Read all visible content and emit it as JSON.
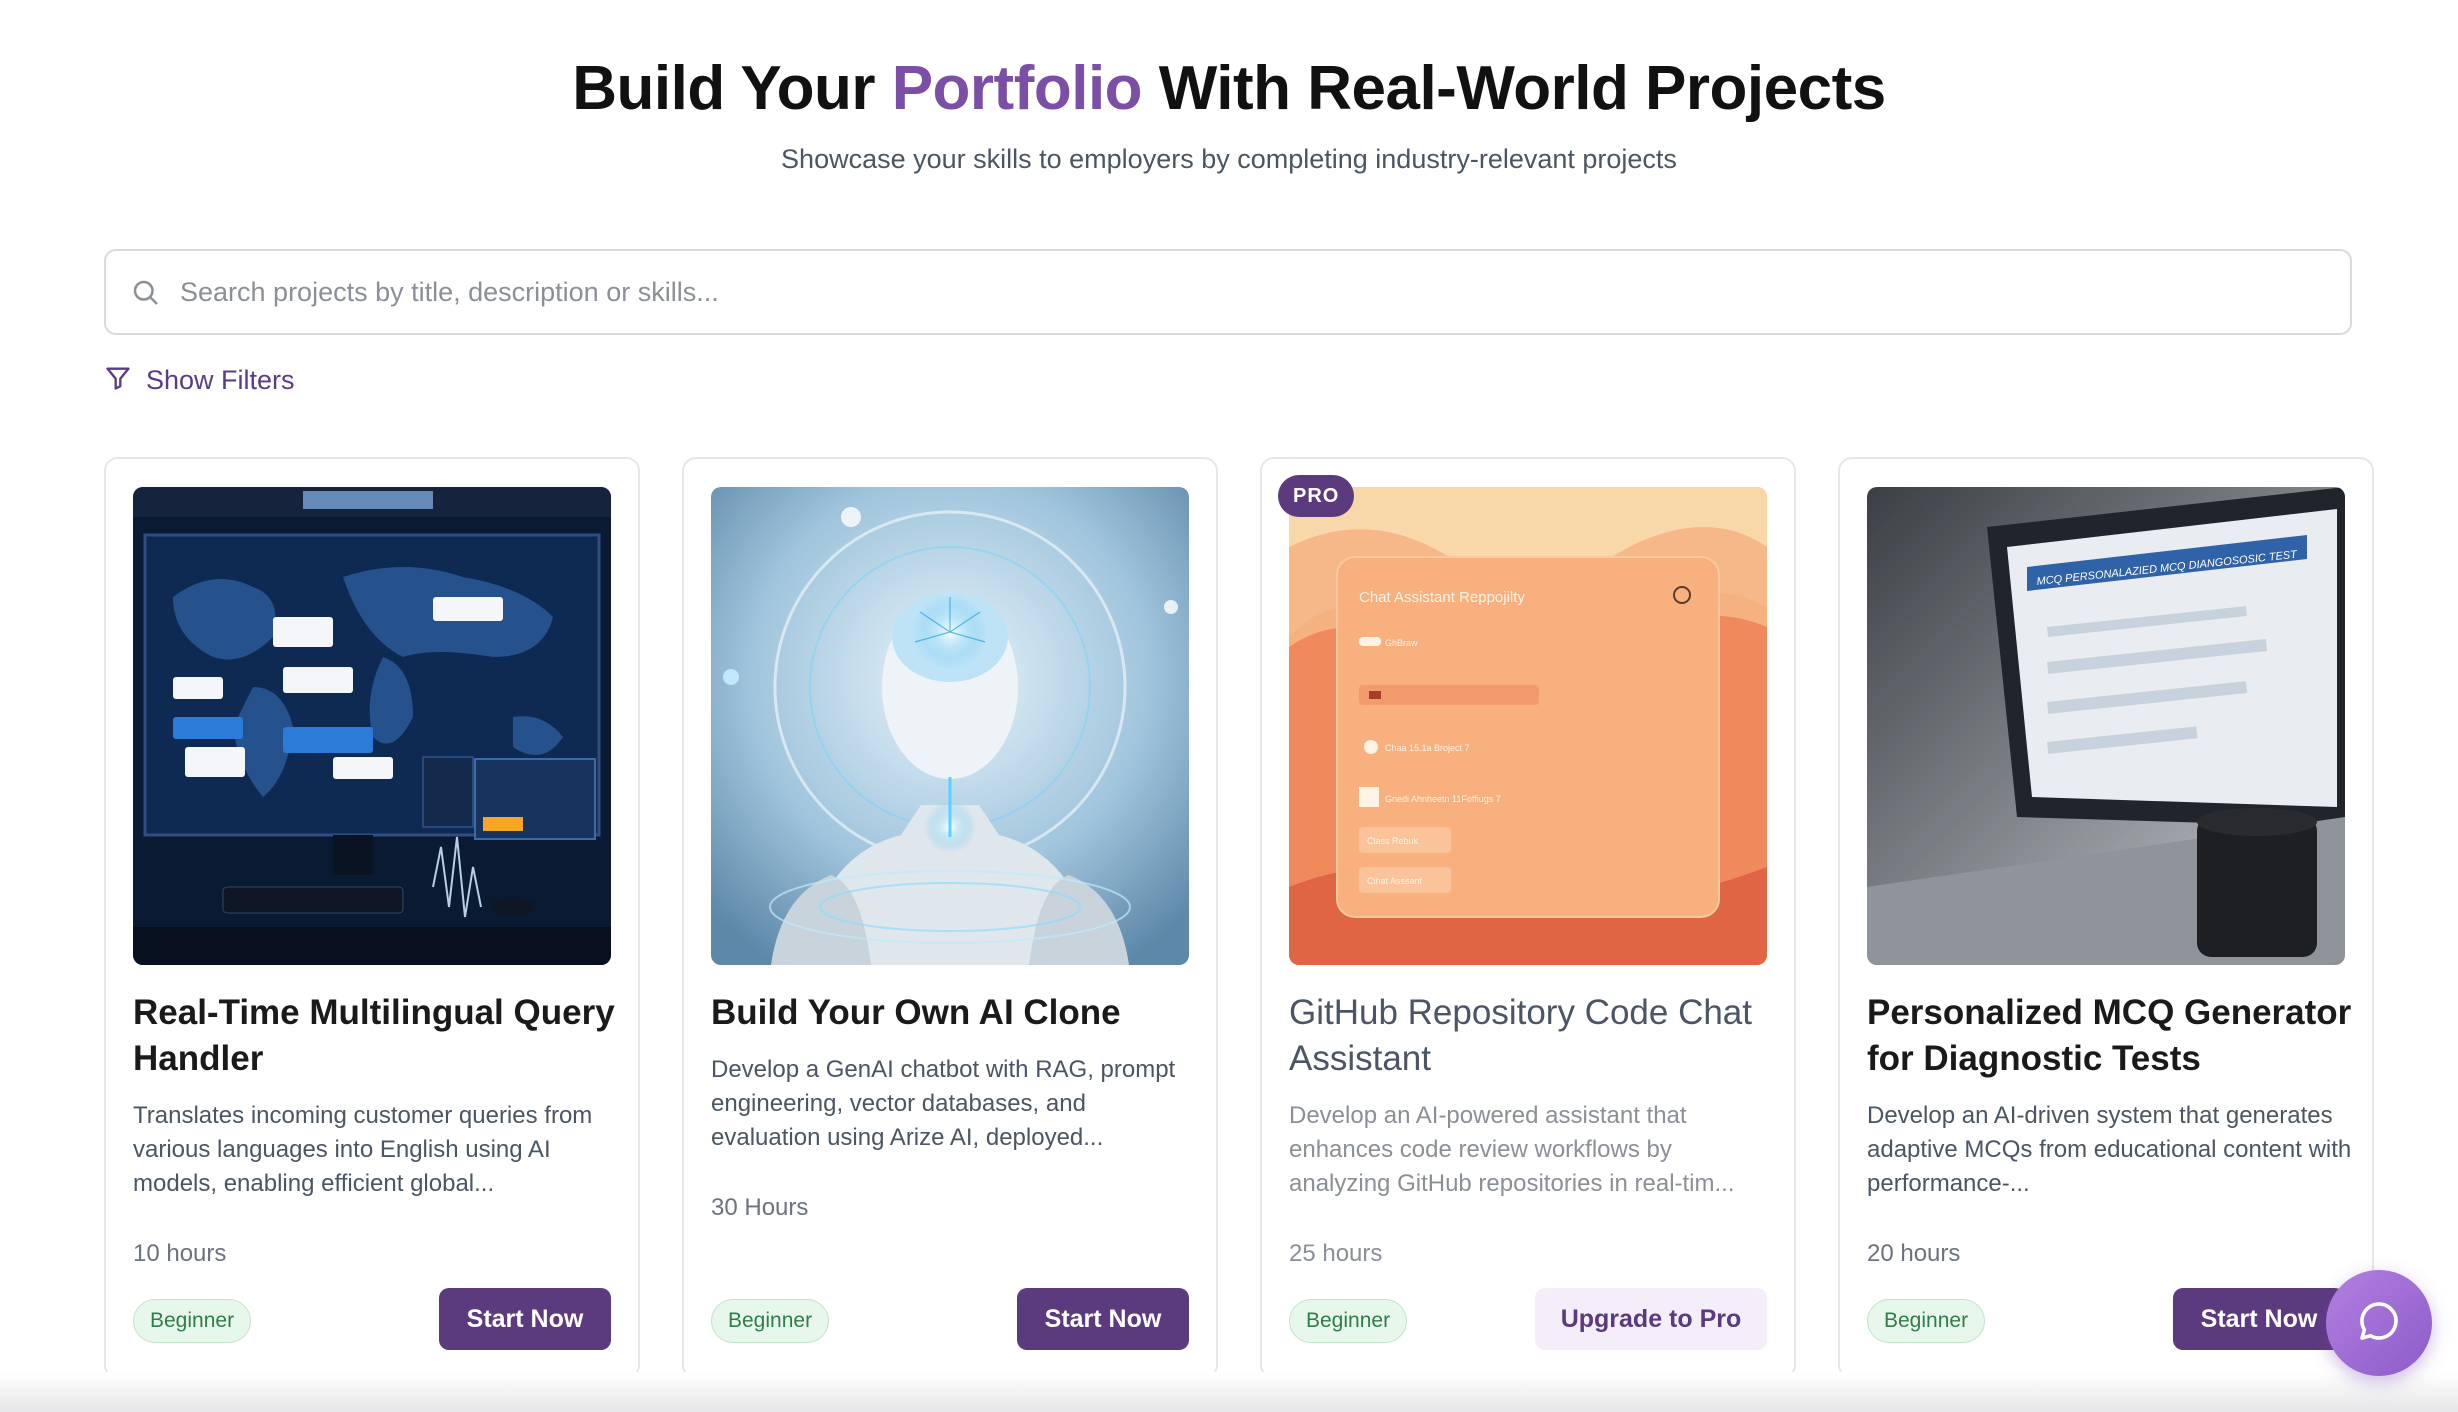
{
  "header": {
    "title_before": "Build Your ",
    "title_accent": "Portfolio",
    "title_after": " With Real-World Projects",
    "subtitle": "Showcase your skills to employers by completing industry-relevant projects"
  },
  "search": {
    "placeholder": "Search projects by title, description or skills...",
    "value": ""
  },
  "filters": {
    "label": "Show Filters"
  },
  "colors": {
    "accent": "#7b4fa5",
    "button": "#5b3a7e",
    "badge_bg": "#e8f7ec",
    "badge_text": "#2f7d4a"
  },
  "cards": [
    {
      "title": "Real-Time Multilingual Query Handler",
      "description": "Translates incoming customer queries from various languages into English using AI models, enabling efficient global...",
      "duration": "10 hours",
      "level": "Beginner",
      "action": "Start Now"
    },
    {
      "title": "Build Your Own AI Clone",
      "description": "Develop a GenAI chatbot with RAG, prompt engineering, vector databases, and evaluation using Arize AI, deployed...",
      "duration": "30 Hours",
      "level": "Beginner",
      "action": "Start Now"
    },
    {
      "badge": "PRO",
      "title": "GitHub Repository Code Chat Assistant",
      "description": "Develop an AI-powered assistant that enhances code review workflows by analyzing GitHub repositories in real-tim...",
      "duration": "25 hours",
      "level": "Beginner",
      "action": "Upgrade to Pro",
      "image_texts": {
        "window_title": "Chat Assistant Reppojilty",
        "row1": "GhBraw",
        "row3": "Chaa 15.1a Broject 7",
        "row4": "Gnedi Ahnheetn 11Foffiugs 7",
        "btn1": "Class Rebuk",
        "btn2": "Cihat Asssant"
      }
    },
    {
      "title": "Personalized MCQ Generator for Diagnostic Tests",
      "description": "Develop an AI-driven system that generates adaptive MCQs from educational content with performance-...",
      "duration": "20 hours",
      "level": "Beginner",
      "action": "Start Now",
      "image_texts": {
        "screen_header": "MCQ PERSONALAZIED MCQ DIANGOSOSIC TEST"
      }
    }
  ],
  "chat_widget": {
    "icon": "chat-bubble-icon"
  }
}
